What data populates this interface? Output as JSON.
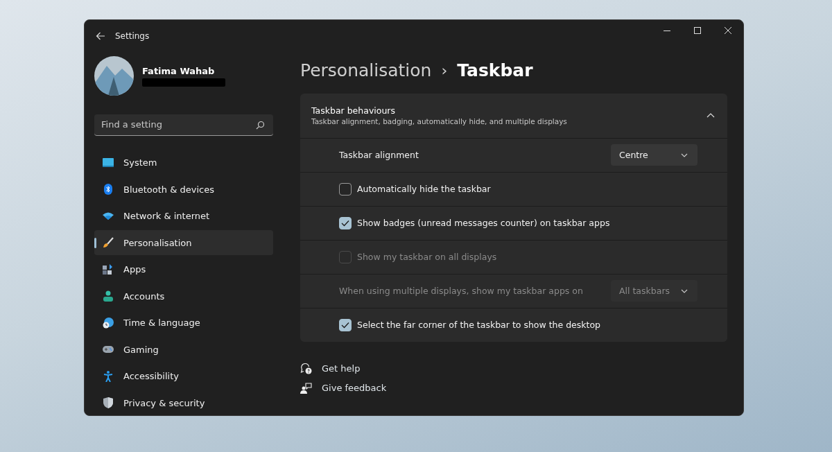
{
  "window": {
    "title": "Settings"
  },
  "profile": {
    "name": "Fatima Wahab"
  },
  "search": {
    "placeholder": "Find a setting"
  },
  "sidebar": {
    "items": [
      {
        "label": "System",
        "selected": false
      },
      {
        "label": "Bluetooth & devices",
        "selected": false
      },
      {
        "label": "Network & internet",
        "selected": false
      },
      {
        "label": "Personalisation",
        "selected": true
      },
      {
        "label": "Apps",
        "selected": false
      },
      {
        "label": "Accounts",
        "selected": false
      },
      {
        "label": "Time & language",
        "selected": false
      },
      {
        "label": "Gaming",
        "selected": false
      },
      {
        "label": "Accessibility",
        "selected": false
      },
      {
        "label": "Privacy & security",
        "selected": false
      }
    ]
  },
  "breadcrumb": {
    "parent": "Personalisation",
    "separator": "›",
    "current": "Taskbar"
  },
  "section": {
    "title": "Taskbar behaviours",
    "subtitle": "Taskbar alignment, badging, automatically hide, and multiple displays",
    "expanded": true,
    "rows": [
      {
        "kind": "dropdown",
        "label": "Taskbar alignment",
        "value": "Centre",
        "disabled": false
      },
      {
        "kind": "checkbox",
        "label": "Automatically hide the taskbar",
        "checked": false,
        "disabled": false
      },
      {
        "kind": "checkbox",
        "label": "Show badges (unread messages counter) on taskbar apps",
        "checked": true,
        "disabled": false
      },
      {
        "kind": "checkbox",
        "label": "Show my taskbar on all displays",
        "checked": false,
        "disabled": true
      },
      {
        "kind": "dropdown",
        "label": "When using multiple displays, show my taskbar apps on",
        "value": "All taskbars",
        "disabled": true
      },
      {
        "kind": "checkbox",
        "label": "Select the far corner of the taskbar to show the desktop",
        "checked": true,
        "disabled": false
      }
    ]
  },
  "links": [
    {
      "kind": "help",
      "label": "Get help"
    },
    {
      "kind": "feedback",
      "label": "Give feedback"
    }
  ]
}
